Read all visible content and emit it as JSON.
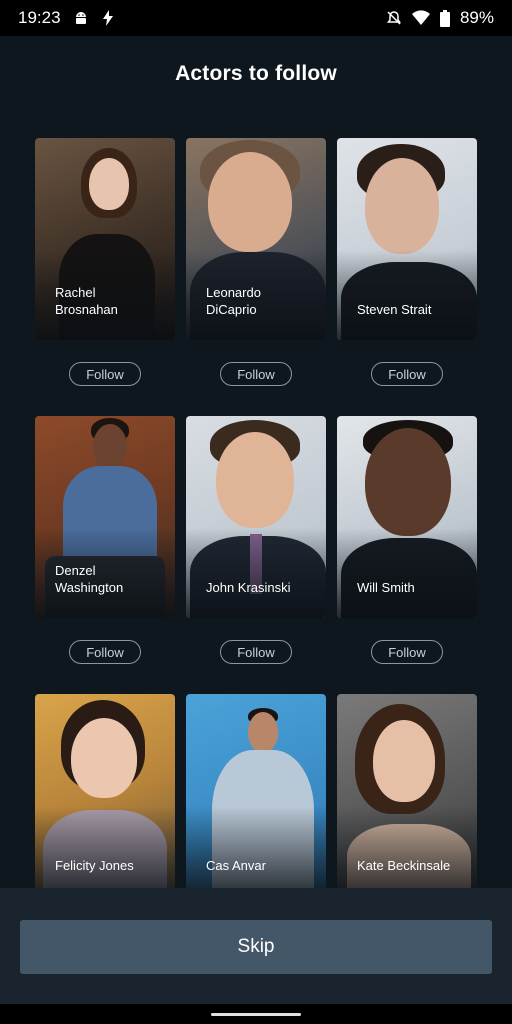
{
  "status": {
    "time": "19:23",
    "battery": "89%"
  },
  "title": "Actors to follow",
  "actors": [
    {
      "name": "Rachel\nBrosnahan",
      "follow": "Follow"
    },
    {
      "name": "Leonardo\nDiCaprio",
      "follow": "Follow"
    },
    {
      "name": "Steven Strait",
      "follow": "Follow"
    },
    {
      "name": "Denzel\nWashington",
      "follow": "Follow"
    },
    {
      "name": "John Krasinski",
      "follow": "Follow"
    },
    {
      "name": "Will Smith",
      "follow": "Follow"
    },
    {
      "name": "Felicity Jones"
    },
    {
      "name": "Cas Anvar"
    },
    {
      "name": "Kate Beckinsale"
    }
  ],
  "skip_label": "Skip",
  "colors": {
    "background": "#0f171e",
    "skip_button": "#445769",
    "follow_border": "#8a96a3"
  }
}
